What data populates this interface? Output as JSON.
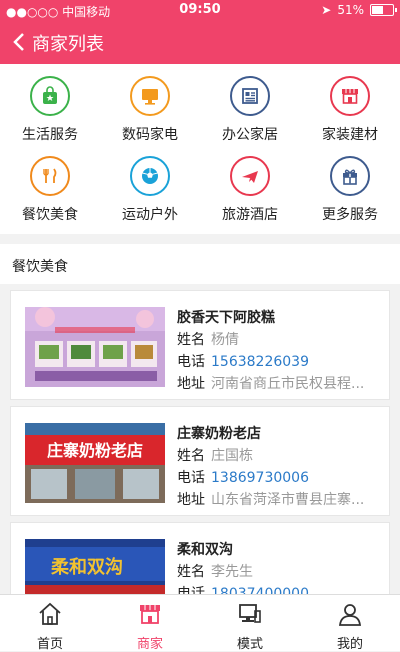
{
  "status_bar": {
    "carrier": "●●○○○ 中国移动",
    "time": "09:50",
    "battery": "51%",
    "battery_fraction": 0.51
  },
  "nav": {
    "title": "商家列表"
  },
  "categories": [
    {
      "label": "生活服务",
      "icon": "shopping-bag-icon",
      "color": "#3bb24a"
    },
    {
      "label": "数码家电",
      "icon": "monitor-icon",
      "color": "#f39a1e"
    },
    {
      "label": "办公家居",
      "icon": "newspaper-icon",
      "color": "#3e5b8e"
    },
    {
      "label": "家装建材",
      "icon": "storefront-icon",
      "color": "#e8384f"
    },
    {
      "label": "餐饮美食",
      "icon": "fork-knife-icon",
      "color": "#f08a1c"
    },
    {
      "label": "运动户外",
      "icon": "soccer-ball-icon",
      "color": "#1aa2d8"
    },
    {
      "label": "旅游酒店",
      "icon": "airplane-icon",
      "color": "#e8384f"
    },
    {
      "label": "更多服务",
      "icon": "gift-icon",
      "color": "#3e5b8e"
    }
  ],
  "section": {
    "title": "餐饮美食"
  },
  "merchants": [
    {
      "name": "胶香天下阿胶糕",
      "name_label": "姓名",
      "contact": "杨倩",
      "phone_label": "电话",
      "phone": "15638226039",
      "addr_label": "地址",
      "address": "河南省商丘市民权县程..."
    },
    {
      "name": "庄寨奶粉老店",
      "name_label": "姓名",
      "contact": "庄国栋",
      "phone_label": "电话",
      "phone": "13869730006",
      "addr_label": "地址",
      "address": "山东省菏泽市曹县庄寨..."
    },
    {
      "name": "柔和双沟",
      "name_label": "姓名",
      "contact": "李先生",
      "phone_label": "电话",
      "phone": "18037400000"
    }
  ],
  "tabs": [
    {
      "label": "首页",
      "icon": "home-icon",
      "active": false
    },
    {
      "label": "商家",
      "icon": "store-icon",
      "active": true
    },
    {
      "label": "模式",
      "icon": "computer-icon",
      "active": false
    },
    {
      "label": "我的",
      "icon": "user-icon",
      "active": false
    }
  ],
  "colors": {
    "brand": "#f0436a",
    "link": "#2b7ac8"
  },
  "thumb_text": {
    "sign2": "庄寨奶粉老店",
    "sign3": "柔和双沟"
  }
}
